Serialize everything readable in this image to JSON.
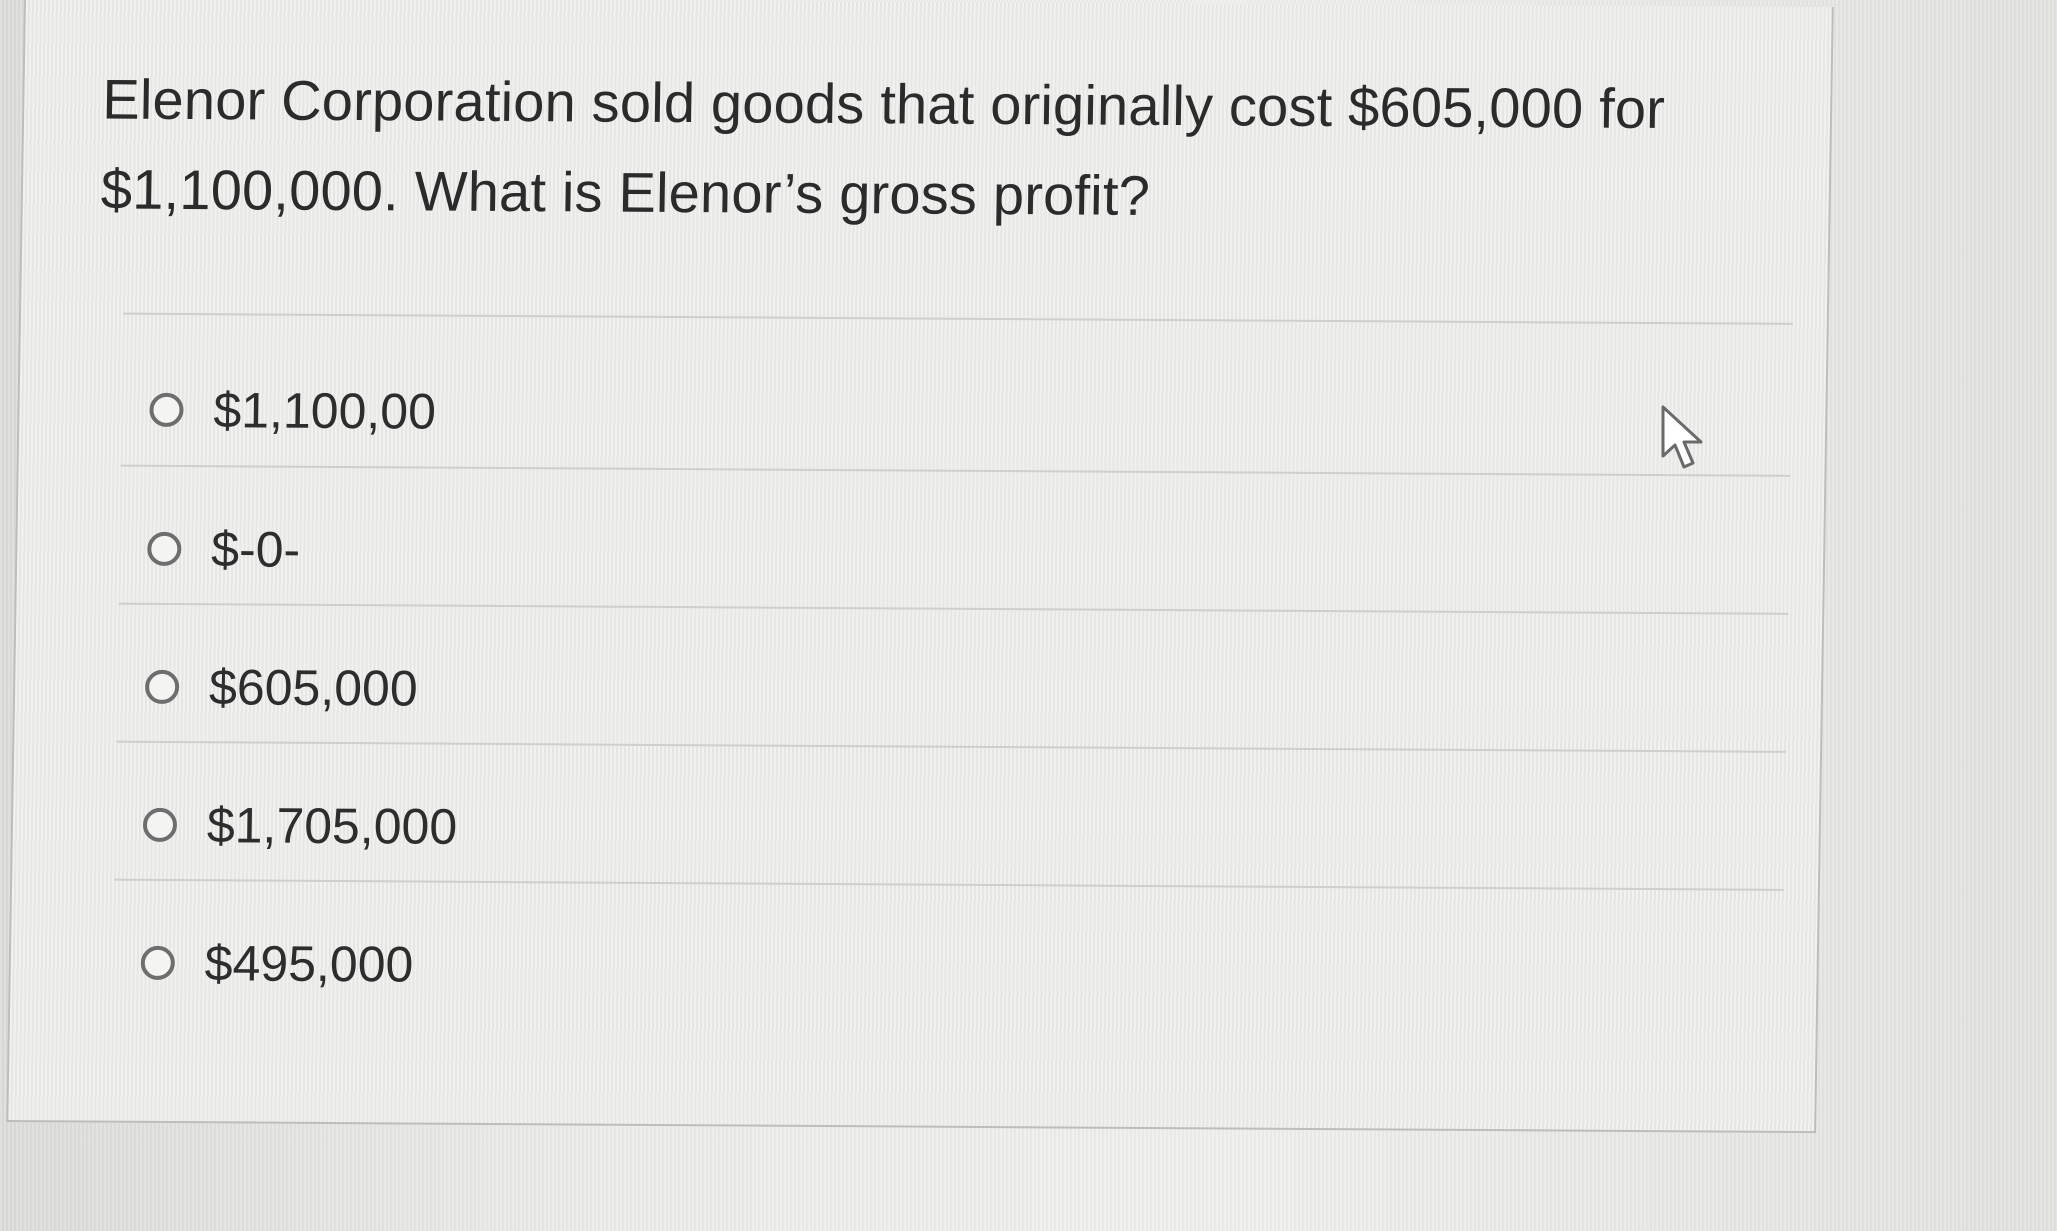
{
  "question": {
    "text": "Elenor Corporation sold goods that originally cost $605,000 for $1,100,000. What is Elenor’s gross profit?"
  },
  "options": [
    {
      "label": "$1,100,00",
      "selected": false
    },
    {
      "label": "$-0-",
      "selected": false
    },
    {
      "label": "$605,000",
      "selected": false
    },
    {
      "label": "$1,705,000",
      "selected": false
    },
    {
      "label": "$495,000",
      "selected": false
    }
  ],
  "cursor": {
    "icon": "mouse-pointer-icon"
  }
}
